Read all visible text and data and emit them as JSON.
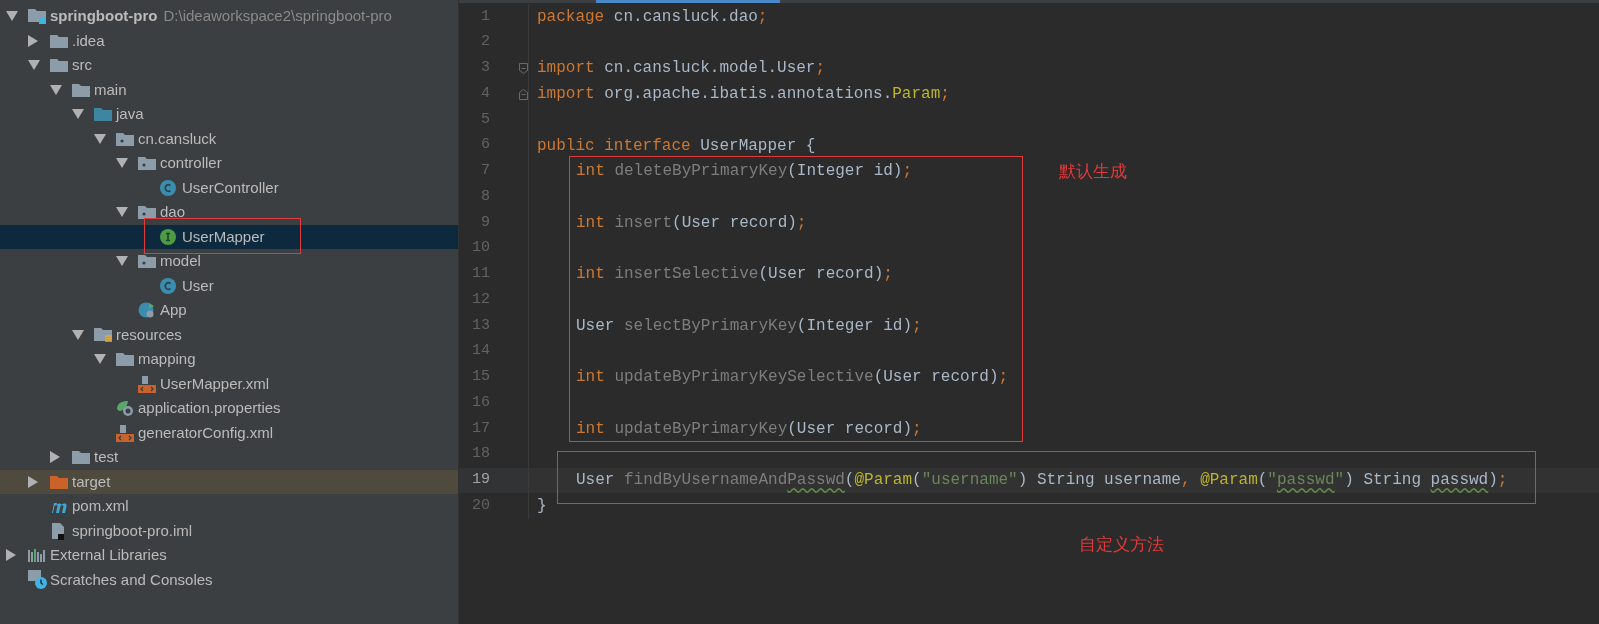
{
  "project_tree": [
    {
      "label": "springboot-pro",
      "path": "D:\\ideaworkspace2\\springboot-pro",
      "kind": "module",
      "expanded": true,
      "selected": false,
      "children": [
        {
          "label": ".idea",
          "kind": "folder",
          "expanded": false,
          "selected": false
        },
        {
          "label": "src",
          "kind": "folder",
          "expanded": true,
          "selected": false,
          "children": [
            {
              "label": "main",
              "kind": "folder",
              "expanded": true,
              "selected": false,
              "children": [
                {
                  "label": "java",
                  "kind": "sources",
                  "expanded": true,
                  "selected": false,
                  "children": [
                    {
                      "label": "cn.cansluck",
                      "kind": "package",
                      "expanded": true,
                      "selected": false,
                      "children": [
                        {
                          "label": "controller",
                          "kind": "package",
                          "expanded": true,
                          "selected": false,
                          "children": [
                            {
                              "label": "UserController",
                              "kind": "class",
                              "selected": false
                            }
                          ]
                        },
                        {
                          "label": "dao",
                          "kind": "package",
                          "expanded": true,
                          "selected": false,
                          "children": [
                            {
                              "label": "UserMapper",
                              "kind": "interface",
                              "selected": true
                            }
                          ]
                        },
                        {
                          "label": "model",
                          "kind": "package",
                          "expanded": true,
                          "selected": false,
                          "children": [
                            {
                              "label": "User",
                              "kind": "class",
                              "selected": false
                            }
                          ]
                        },
                        {
                          "label": "App",
                          "kind": "app",
                          "selected": false
                        }
                      ]
                    }
                  ]
                },
                {
                  "label": "resources",
                  "kind": "resources",
                  "expanded": true,
                  "selected": false,
                  "children": [
                    {
                      "label": "mapping",
                      "kind": "folder",
                      "expanded": true,
                      "selected": false,
                      "children": [
                        {
                          "label": "UserMapper.xml",
                          "kind": "xml",
                          "selected": false
                        }
                      ]
                    },
                    {
                      "label": "application.properties",
                      "kind": "properties",
                      "selected": false
                    },
                    {
                      "label": "generatorConfig.xml",
                      "kind": "xml",
                      "selected": false
                    }
                  ]
                }
              ]
            },
            {
              "label": "test",
              "kind": "folder",
              "expanded": false,
              "selected": false
            }
          ]
        },
        {
          "label": "target",
          "kind": "excluded",
          "expanded": false,
          "selected": false
        },
        {
          "label": "pom.xml",
          "kind": "maven",
          "selected": false
        },
        {
          "label": "springboot-pro.iml",
          "kind": "iml",
          "selected": false
        }
      ]
    },
    {
      "label": "External Libraries",
      "kind": "libraries",
      "expanded": false,
      "selected": false
    },
    {
      "label": "Scratches and Consoles",
      "kind": "scratches",
      "selected": false
    }
  ],
  "editor": {
    "lines": [
      {
        "number": "1",
        "tokens": [
          {
            "text": "package",
            "kind": "keyword"
          },
          {
            "text": " cn.cansluck.dao",
            "kind": "plain"
          },
          {
            "text": ";",
            "kind": "punct"
          }
        ]
      },
      {
        "number": "2"
      },
      {
        "number": "3",
        "kind": "import",
        "tokens": [
          {
            "text": "import",
            "kind": "keyword"
          },
          {
            "text": " cn.cansluck.model.User",
            "kind": "plain"
          },
          {
            "text": ";",
            "kind": "punct"
          }
        ]
      },
      {
        "number": "4",
        "kind": "import",
        "tokens": [
          {
            "text": "import",
            "kind": "keyword"
          },
          {
            "text": " org.apache.ibatis.annotations.",
            "kind": "plain"
          },
          {
            "text": "Param",
            "kind": "annotation"
          },
          {
            "text": ";",
            "kind": "punct"
          }
        ]
      },
      {
        "number": "5"
      },
      {
        "number": "6",
        "tokens": [
          {
            "text": "public interface",
            "kind": "keyword"
          },
          {
            "text": " UserMapper {",
            "kind": "plain"
          }
        ]
      },
      {
        "number": "7",
        "indent": true,
        "tokens": [
          {
            "text": "int",
            "kind": "keyword"
          },
          {
            "text": " deleteByPrimaryKey",
            "kind": "unused"
          },
          {
            "text": "(Integer id)",
            "kind": "plain"
          },
          {
            "text": ";",
            "kind": "punct"
          }
        ]
      },
      {
        "number": "8"
      },
      {
        "number": "9",
        "indent": true,
        "tokens": [
          {
            "text": "int",
            "kind": "keyword"
          },
          {
            "text": " insert",
            "kind": "unused"
          },
          {
            "text": "(User record)",
            "kind": "plain"
          },
          {
            "text": ";",
            "kind": "punct"
          }
        ]
      },
      {
        "number": "10"
      },
      {
        "number": "11",
        "indent": true,
        "tokens": [
          {
            "text": "int",
            "kind": "keyword"
          },
          {
            "text": " insertSelective",
            "kind": "unused"
          },
          {
            "text": "(User record)",
            "kind": "plain"
          },
          {
            "text": ";",
            "kind": "punct"
          }
        ]
      },
      {
        "number": "12"
      },
      {
        "number": "13",
        "indent": true,
        "tokens": [
          {
            "text": "User",
            "kind": "plain"
          },
          {
            "text": " selectByPrimaryKey",
            "kind": "unused"
          },
          {
            "text": "(Integer id)",
            "kind": "plain"
          },
          {
            "text": ";",
            "kind": "punct"
          }
        ]
      },
      {
        "number": "14"
      },
      {
        "number": "15",
        "indent": true,
        "tokens": [
          {
            "text": "int",
            "kind": "keyword"
          },
          {
            "text": " updateByPrimaryKeySelective",
            "kind": "unused"
          },
          {
            "text": "(User record)",
            "kind": "plain"
          },
          {
            "text": ";",
            "kind": "punct"
          }
        ]
      },
      {
        "number": "16"
      },
      {
        "number": "17",
        "indent": true,
        "tokens": [
          {
            "text": "int",
            "kind": "keyword"
          },
          {
            "text": " updateByPrimaryKey",
            "kind": "unused"
          },
          {
            "text": "(User record)",
            "kind": "plain"
          },
          {
            "text": ";",
            "kind": "punct"
          }
        ]
      },
      {
        "number": "18"
      },
      {
        "number": "19",
        "indent": true,
        "current": true,
        "tokens": [
          {
            "text": "User",
            "kind": "plain"
          },
          {
            "text": " findByUsernameAnd",
            "kind": "unused"
          },
          {
            "text": "Passwd",
            "kind": "unused",
            "typo": true
          },
          {
            "text": "(",
            "kind": "plain"
          },
          {
            "text": "@Param",
            "kind": "annotation"
          },
          {
            "text": "(",
            "kind": "plain"
          },
          {
            "text": "\"username\"",
            "kind": "string"
          },
          {
            "text": ") String username",
            "kind": "plain"
          },
          {
            "text": ", ",
            "kind": "punct"
          },
          {
            "text": "@Param",
            "kind": "annotation"
          },
          {
            "text": "(",
            "kind": "plain"
          },
          {
            "text": "\"",
            "kind": "string"
          },
          {
            "text": "passwd",
            "kind": "string",
            "typo": true
          },
          {
            "text": "\"",
            "kind": "string"
          },
          {
            "text": ") String ",
            "kind": "plain"
          },
          {
            "text": "passwd",
            "kind": "plain",
            "typo": true
          },
          {
            "text": ")",
            "kind": "plain"
          },
          {
            "text": ";",
            "kind": "punct"
          }
        ]
      },
      {
        "number": "20",
        "tokens": [
          {
            "text": "}",
            "kind": "plain"
          }
        ]
      }
    ]
  },
  "annotations": [
    {
      "text": "默认生成"
    },
    {
      "text": "自定义方法"
    }
  ]
}
